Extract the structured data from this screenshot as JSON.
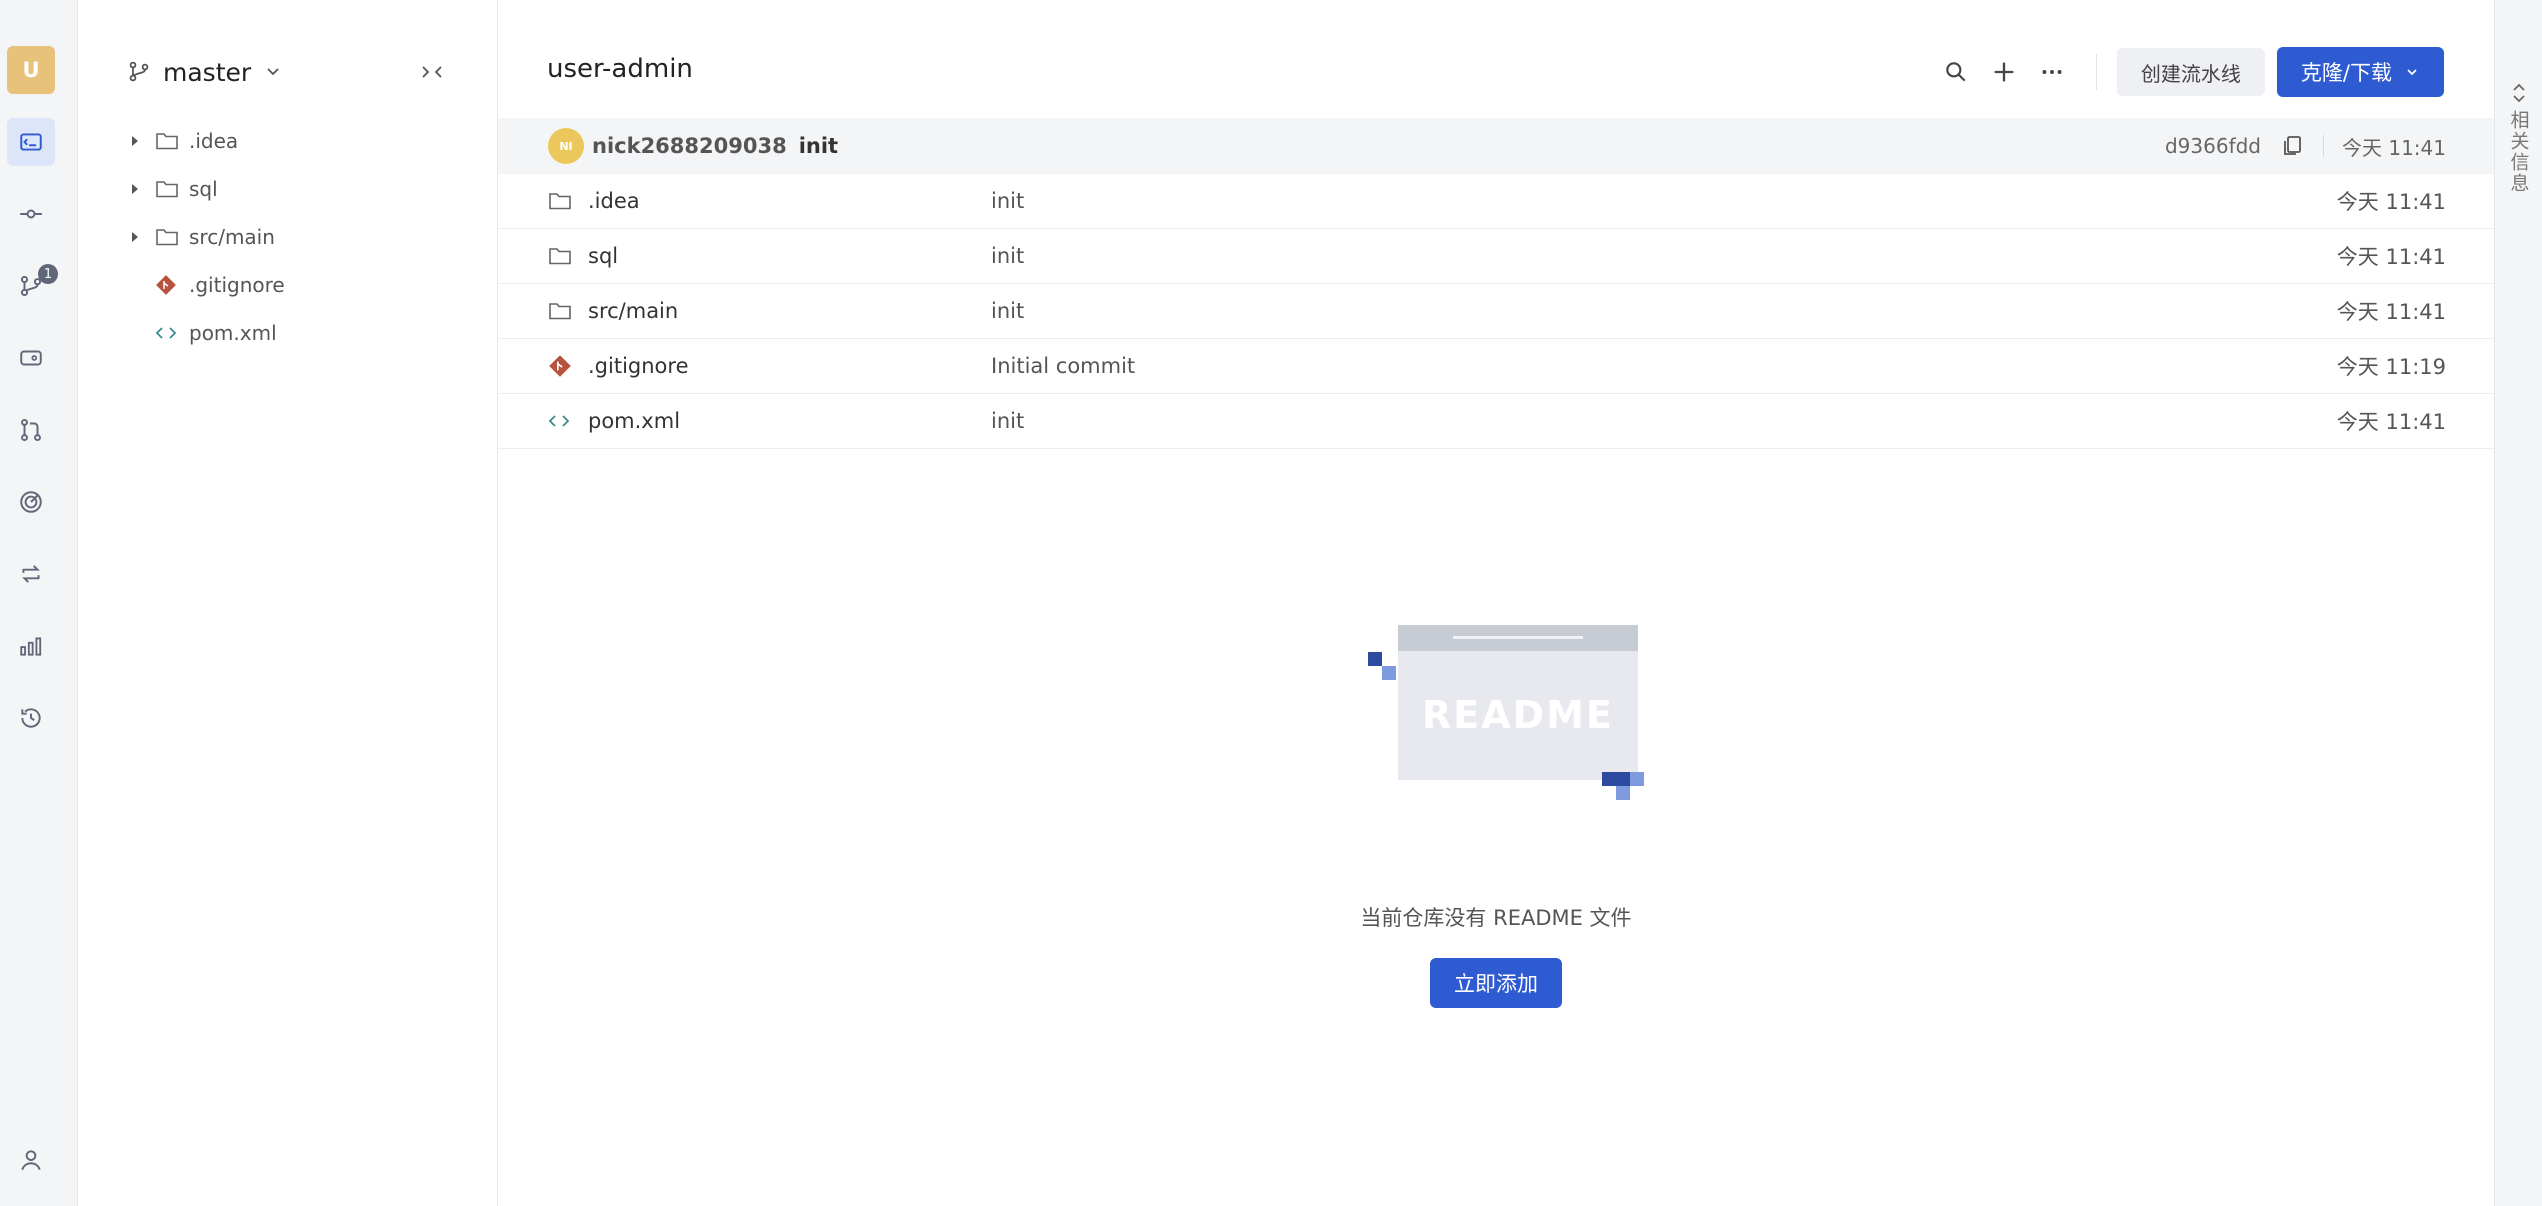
{
  "rail": {
    "avatar": "U",
    "items": [
      {
        "name": "code-icon",
        "active": true
      },
      {
        "name": "commit-icon",
        "active": false
      },
      {
        "name": "branch-icon",
        "active": false,
        "badge": "1"
      },
      {
        "name": "tag-icon",
        "active": false
      },
      {
        "name": "merge-request-icon",
        "active": false
      },
      {
        "name": "target-icon",
        "active": false
      },
      {
        "name": "compare-icon",
        "active": false
      },
      {
        "name": "chart-icon",
        "active": false
      },
      {
        "name": "history-icon",
        "active": false
      }
    ],
    "bottom_icon": "user-icon"
  },
  "tree": {
    "branch": "master",
    "items": [
      {
        "label": ".idea",
        "type": "folder"
      },
      {
        "label": "sql",
        "type": "folder"
      },
      {
        "label": "src/main",
        "type": "folder"
      },
      {
        "label": ".gitignore",
        "type": "git"
      },
      {
        "label": "pom.xml",
        "type": "code"
      }
    ]
  },
  "main": {
    "title": "user-admin",
    "toolbar": {
      "pipeline_button": "创建流水线",
      "clone_button": "克隆/下载"
    },
    "commit": {
      "avatar": "NI",
      "author": "nick2688209038",
      "message": "init",
      "hash": "d9366fdd",
      "time": "今天 11:41"
    },
    "files": [
      {
        "name": ".idea",
        "type": "folder",
        "message": "init",
        "time": "今天 11:41"
      },
      {
        "name": "sql",
        "type": "folder",
        "message": "init",
        "time": "今天 11:41"
      },
      {
        "name": "src/main",
        "type": "folder",
        "message": "init",
        "time": "今天 11:41"
      },
      {
        "name": ".gitignore",
        "type": "git",
        "message": "Initial commit",
        "time": "今天 11:19"
      },
      {
        "name": "pom.xml",
        "type": "code",
        "message": "init",
        "time": "今天 11:41"
      }
    ],
    "empty": {
      "illustration_text": "README",
      "text": "当前仓库没有 README 文件",
      "button": "立即添加"
    }
  },
  "side_panel": {
    "label": "相关信息"
  },
  "colors": {
    "primary": "#2f5bd2",
    "avatar": "#e8c27a",
    "commit_avatar": "#ecc85c",
    "git_icon": "#b5533e"
  }
}
